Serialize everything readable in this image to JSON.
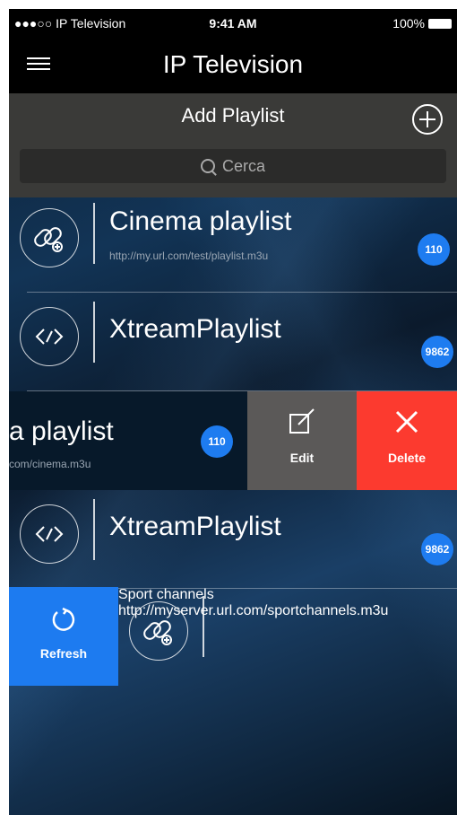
{
  "status_bar": {
    "carrier": "●●●○○ IP Television",
    "time": "9:41 AM",
    "battery": "100%"
  },
  "nav": {
    "title": "IP Television"
  },
  "add_bar": {
    "label": "Add Playlist"
  },
  "search": {
    "placeholder": "Cerca"
  },
  "playlists": [
    {
      "name": "Cinema playlist",
      "url": "http://my.url.com/test/playlist.m3u",
      "count": "110",
      "icon": "link-icon"
    },
    {
      "name": "XtreamPlaylist",
      "url": "",
      "count": "9862",
      "icon": "code-icon"
    },
    {
      "name": "a playlist",
      "url": "com/cinema.m3u",
      "count": "110",
      "icon": "link-icon"
    },
    {
      "name": "XtreamPlaylist",
      "url": "",
      "count": "9862",
      "icon": "code-icon"
    },
    {
      "name": "Sport channels",
      "url": "http://myserver.url.com/sportchannels.m3u",
      "count": "",
      "icon": "link-icon"
    }
  ],
  "actions": {
    "edit": "Edit",
    "delete": "Delete",
    "refresh": "Refresh"
  },
  "colors": {
    "accent_blue": "#1e7cf0",
    "delete_red": "#fc3a2f",
    "edit_gray": "#5b5958"
  }
}
